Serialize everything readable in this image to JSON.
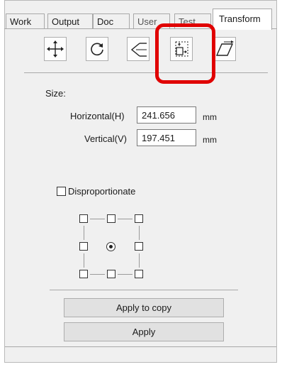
{
  "tabs": [
    {
      "label": "Work"
    },
    {
      "label": "Output"
    },
    {
      "label": "Doc"
    },
    {
      "label": "User"
    },
    {
      "label": "Test"
    },
    {
      "label": "Transform",
      "active": true
    }
  ],
  "toolbar": {
    "tools": [
      {
        "name": "move-icon"
      },
      {
        "name": "rotate-icon"
      },
      {
        "name": "mirror-icon"
      },
      {
        "name": "scale-icon",
        "highlighted": true
      },
      {
        "name": "skew-icon"
      }
    ]
  },
  "size": {
    "title": "Size:",
    "horizontal_label": "Horizontal(H)",
    "horizontal_value": "241.656",
    "horizontal_unit": "mm",
    "vertical_label": "Vertical(V)",
    "vertical_value": "197.451",
    "vertical_unit": "mm"
  },
  "options": {
    "disproportionate_label": "Disproportionate",
    "disproportionate_checked": false,
    "anchor_selected": "center"
  },
  "buttons": {
    "apply_to_copy": "Apply to copy",
    "apply": "Apply"
  },
  "colors": {
    "highlight": "#e00000",
    "panel": "#f0f0f0"
  }
}
